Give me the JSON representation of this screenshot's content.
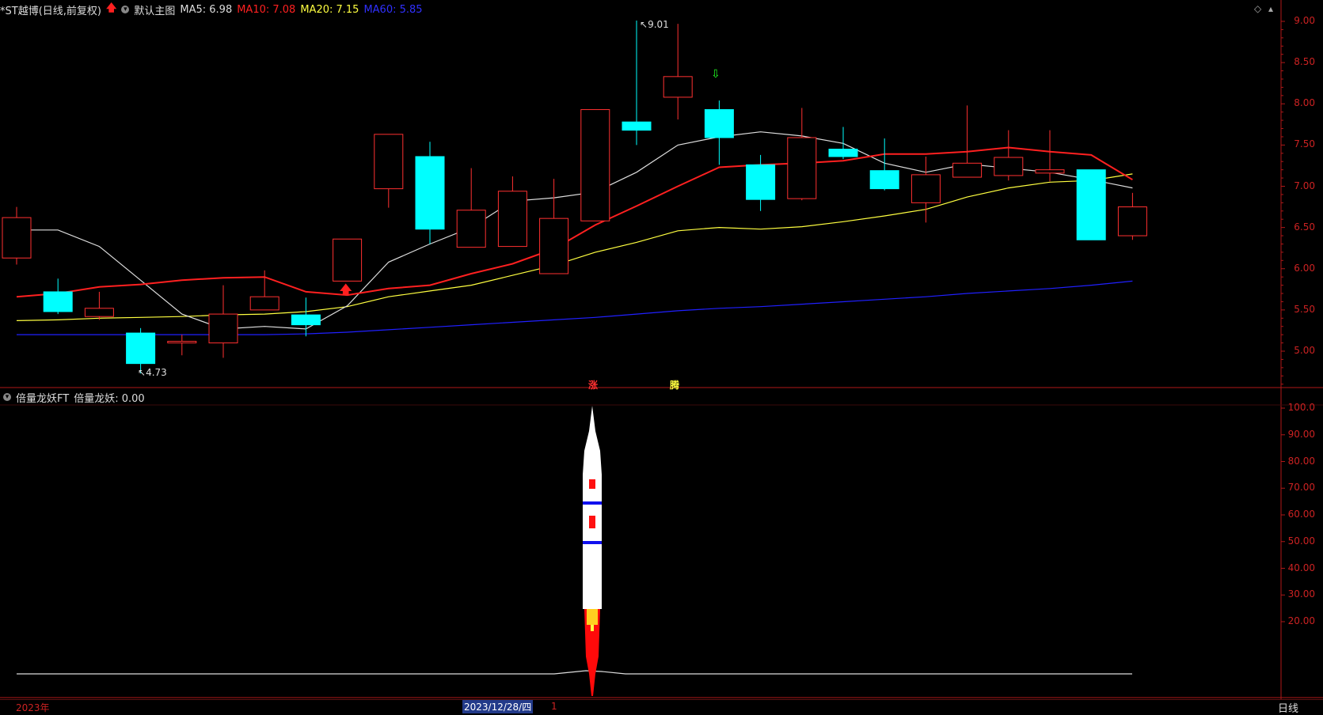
{
  "header": {
    "title": "*ST越博(日线,前复权)",
    "theme": "默认主图",
    "ma5": "MA5: 6.98",
    "ma10": "MA10: 7.08",
    "ma20": "MA20: 7.15",
    "ma60": "MA60: 5.85"
  },
  "sub_header": {
    "indicator": "倍量龙妖FT",
    "value": "倍量龙妖: 0.00"
  },
  "colors": {
    "up": "#ff3030",
    "down": "#00ffff",
    "ma5": "#dddddd",
    "ma10": "#ff2020",
    "ma20": "#ffff40",
    "ma60": "#2020ff",
    "axis": "#b01818"
  },
  "price_axis": [
    "9.00",
    "8.50",
    "8.00",
    "7.50",
    "7.00",
    "6.50",
    "6.00",
    "5.50",
    "5.00"
  ],
  "indicator_axis": [
    "100.0",
    "90.00",
    "80.00",
    "70.00",
    "60.00",
    "50.00",
    "40.00",
    "30.00",
    "20.00"
  ],
  "annotations": {
    "high": "9.01",
    "low": "4.73",
    "zhang": "涨",
    "teng": "腾"
  },
  "footer": {
    "year": "2023年",
    "date": "2023/12/28/四",
    "page": "1",
    "period": "日线"
  },
  "chart_data": {
    "type": "candlestick",
    "ylim": [
      4.5,
      9.1
    ],
    "candles": [
      {
        "o": 6.13,
        "h": 6.75,
        "l": 6.05,
        "c": 6.62
      },
      {
        "o": 5.72,
        "h": 5.88,
        "l": 5.45,
        "c": 5.48
      },
      {
        "o": 5.42,
        "h": 5.72,
        "l": 5.38,
        "c": 5.52
      },
      {
        "o": 5.22,
        "h": 5.28,
        "l": 4.73,
        "c": 4.85
      },
      {
        "o": 5.1,
        "h": 5.2,
        "l": 4.95,
        "c": 5.12
      },
      {
        "o": 5.1,
        "h": 5.8,
        "l": 4.92,
        "c": 5.45
      },
      {
        "o": 5.5,
        "h": 5.98,
        "l": 5.5,
        "c": 5.66
      },
      {
        "o": 5.44,
        "h": 5.65,
        "l": 5.18,
        "c": 5.32
      },
      {
        "o": 5.85,
        "h": 6.36,
        "l": 5.85,
        "c": 6.36
      },
      {
        "o": 6.97,
        "h": 7.63,
        "l": 6.74,
        "c": 7.63
      },
      {
        "o": 7.36,
        "h": 7.54,
        "l": 6.3,
        "c": 6.48
      },
      {
        "o": 6.26,
        "h": 7.22,
        "l": 6.26,
        "c": 6.71
      },
      {
        "o": 6.27,
        "h": 7.12,
        "l": 6.27,
        "c": 6.94
      },
      {
        "o": 5.94,
        "h": 7.09,
        "l": 5.94,
        "c": 6.61
      },
      {
        "o": 6.58,
        "h": 7.93,
        "l": 6.58,
        "c": 7.93
      },
      {
        "o": 7.78,
        "h": 9.01,
        "l": 7.5,
        "c": 7.68
      },
      {
        "o": 8.08,
        "h": 8.97,
        "l": 7.81,
        "c": 8.33
      },
      {
        "o": 7.93,
        "h": 8.04,
        "l": 7.26,
        "c": 7.59
      },
      {
        "o": 7.26,
        "h": 7.38,
        "l": 6.7,
        "c": 6.84
      },
      {
        "o": 6.85,
        "h": 7.95,
        "l": 6.83,
        "c": 7.59
      },
      {
        "o": 7.45,
        "h": 7.72,
        "l": 7.33,
        "c": 7.36
      },
      {
        "o": 7.19,
        "h": 7.58,
        "l": 6.95,
        "c": 6.97
      },
      {
        "o": 6.8,
        "h": 7.36,
        "l": 6.56,
        "c": 7.14
      },
      {
        "o": 7.11,
        "h": 7.98,
        "l": 7.11,
        "c": 7.28
      },
      {
        "o": 7.13,
        "h": 7.68,
        "l": 7.07,
        "c": 7.35
      },
      {
        "o": 7.16,
        "h": 7.68,
        "l": 7.06,
        "c": 7.2
      },
      {
        "o": 7.2,
        "h": 7.2,
        "l": 6.35,
        "c": 6.35
      },
      {
        "o": 6.4,
        "h": 6.92,
        "l": 6.35,
        "c": 6.75
      }
    ],
    "ma5": [
      6.47,
      6.47,
      6.27,
      5.86,
      5.45,
      5.27,
      5.3,
      5.27,
      5.55,
      6.08,
      6.3,
      6.5,
      6.82,
      6.86,
      6.93,
      7.17,
      7.5,
      7.6,
      7.66,
      7.61,
      7.52,
      7.28,
      7.17,
      7.27,
      7.22,
      7.17,
      7.08,
      6.98
    ],
    "ma10": [
      5.66,
      5.7,
      5.78,
      5.81,
      5.86,
      5.89,
      5.9,
      5.72,
      5.68,
      5.76,
      5.8,
      5.94,
      6.06,
      6.24,
      6.53,
      6.76,
      7.0,
      7.23,
      7.26,
      7.28,
      7.31,
      7.39,
      7.39,
      7.42,
      7.47,
      7.42,
      7.38,
      7.08
    ],
    "ma20": [
      5.37,
      5.38,
      5.4,
      5.41,
      5.42,
      5.44,
      5.45,
      5.48,
      5.54,
      5.66,
      5.73,
      5.8,
      5.92,
      6.04,
      6.2,
      6.32,
      6.46,
      6.5,
      6.48,
      6.51,
      6.57,
      6.64,
      6.72,
      6.87,
      6.98,
      7.05,
      7.07,
      7.15
    ],
    "ma60": [
      5.2,
      5.2,
      5.2,
      5.2,
      5.2,
      5.2,
      5.2,
      5.21,
      5.23,
      5.26,
      5.29,
      5.32,
      5.35,
      5.38,
      5.41,
      5.45,
      5.49,
      5.52,
      5.54,
      5.57,
      5.6,
      5.63,
      5.66,
      5.7,
      5.73,
      5.76,
      5.8,
      5.85
    ]
  }
}
